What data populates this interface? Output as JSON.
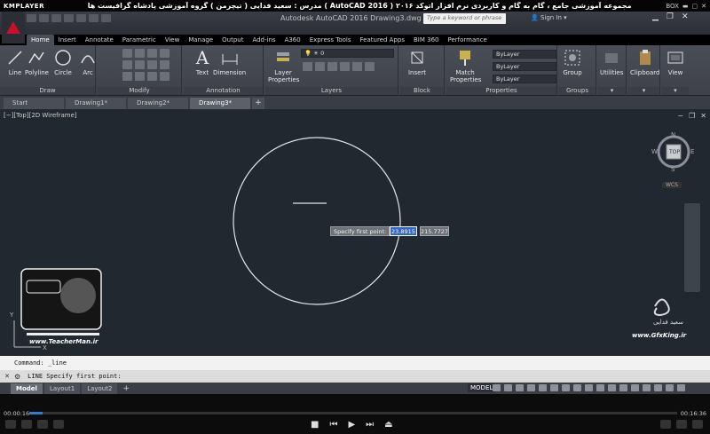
{
  "player": {
    "logo": "KMPLAYER",
    "title": "مجموعه آموزشی جامع ، گام به گام و کاربردی نرم افزار  اتوکد ۲۰۱۶ ( 2016 AutoCAD )   مدرس : سعید فدایی ( تیچرمن ) گروه آموزشی پادشاه گرافیست ها",
    "box_label": "BOX",
    "time_current": "00:00:16",
    "time_total": "00:16:36",
    "progress_fraction": 0.02
  },
  "autocad": {
    "doc_title": "Autodesk AutoCAD 2016   Drawing3.dwg",
    "search_placeholder": "Type a keyword or phrase",
    "signin": "Sign In",
    "ribbon_tabs": [
      "Home",
      "Insert",
      "Annotate",
      "Parametric",
      "View",
      "Manage",
      "Output",
      "Add-ins",
      "A360",
      "Express Tools",
      "Featured Apps",
      "BIM 360",
      "Performance"
    ],
    "active_ribbon_tab": "Home",
    "panels": {
      "draw": {
        "label": "Draw",
        "tools": [
          "Line",
          "Polyline",
          "Circle",
          "Arc"
        ]
      },
      "modify": {
        "label": "Modify"
      },
      "annotation": {
        "label": "Annotation",
        "tools": [
          "Text",
          "Dimension"
        ]
      },
      "layers": {
        "label": "Layers",
        "tool": "Layer Properties",
        "layer_value": "0"
      },
      "block": {
        "label": "Block",
        "tool": "Insert"
      },
      "properties": {
        "label": "Properties",
        "tool": "Match Properties",
        "bylayer": [
          "ByLayer",
          "ByLayer",
          "ByLayer"
        ]
      },
      "groups": {
        "label": "Groups",
        "tool": "Group"
      },
      "utilities": {
        "label": "Utilities"
      },
      "clipboard": {
        "label": "Clipboard"
      },
      "view": {
        "label": "View"
      }
    },
    "doc_tabs": [
      "Start",
      "Drawing1*",
      "Drawing2*",
      "Drawing3*"
    ],
    "active_doc_tab": "Drawing3*",
    "viewport_label": "[−][Top][2D Wireframe]",
    "viewcube": {
      "top": "TOP",
      "n": "N",
      "s": "S",
      "e": "E",
      "w": "W",
      "wcs": "WCS"
    },
    "dynamic_input": {
      "prompt": "Specify first point:",
      "x": "23.8915",
      "y": "215.7727"
    },
    "watermark_left": "www.TeacherMan.ir",
    "watermark_right_name": "سعید فدایی",
    "watermark_right": "www.GfxKing.ir",
    "command_history": "Command: _line",
    "command_prompt": "LINE Specify first point:",
    "layout_tabs": [
      "Model",
      "Layout1",
      "Layout2"
    ],
    "active_layout_tab": "Model",
    "status_model": "MODEL"
  }
}
